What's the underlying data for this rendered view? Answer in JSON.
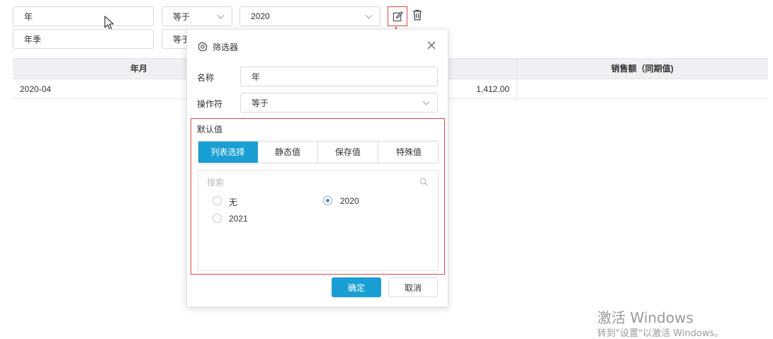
{
  "filter_rows": [
    {
      "name": "年",
      "operator": "等于",
      "value": "2020"
    },
    {
      "name": "年季",
      "operator": "等于"
    }
  ],
  "table": {
    "headers": [
      "年月",
      "销售额（同期值)"
    ],
    "rows": [
      {
        "month": "2020-04",
        "amount": "1,412.00"
      }
    ]
  },
  "dialog": {
    "title": "筛选器",
    "name_label": "名称",
    "name_value": "年",
    "operator_label": "操作符",
    "operator_value": "等于",
    "default_label": "默认值",
    "tabs": [
      "列表选择",
      "静态值",
      "保存值",
      "特殊值"
    ],
    "active_tab": "列表选择",
    "search_placeholder": "搜索",
    "options": [
      {
        "label": "无",
        "selected": false
      },
      {
        "label": "2020",
        "selected": true
      },
      {
        "label": "2021",
        "selected": false
      }
    ],
    "confirm_label": "确定",
    "cancel_label": "取消"
  },
  "watermark": {
    "line1": "激活 Windows",
    "line2": "转到\"设置\"以激活 Windows。"
  },
  "colors": {
    "accent": "#1a9fd5",
    "annotation_red": "#e04848",
    "header_bg": "#eef0f3"
  },
  "icons": [
    "edit-icon",
    "trash-icon",
    "gear-icon",
    "close-icon",
    "search-icon",
    "chevron-down-icon",
    "mouse-cursor-icon"
  ]
}
